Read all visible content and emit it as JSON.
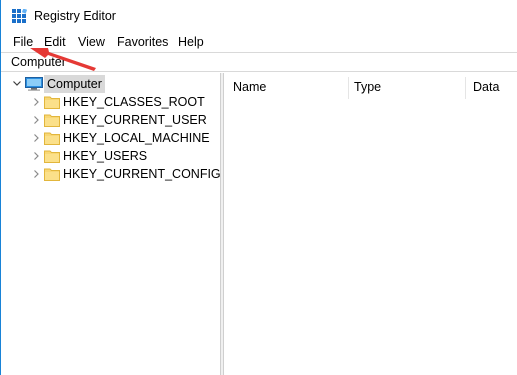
{
  "window": {
    "title": "Registry Editor",
    "accent_color": "#1883d7"
  },
  "menu": {
    "items": [
      {
        "label": "File"
      },
      {
        "label": "Edit"
      },
      {
        "label": "View"
      },
      {
        "label": "Favorites"
      },
      {
        "label": "Help"
      }
    ]
  },
  "address": {
    "path": "Computer"
  },
  "tree": {
    "root": {
      "label": "Computer",
      "icon": "computer-icon",
      "expanded": true,
      "selected": true
    },
    "children": [
      {
        "label": "HKEY_CLASSES_ROOT",
        "icon": "folder-icon"
      },
      {
        "label": "HKEY_CURRENT_USER",
        "icon": "folder-icon"
      },
      {
        "label": "HKEY_LOCAL_MACHINE",
        "icon": "folder-icon"
      },
      {
        "label": "HKEY_USERS",
        "icon": "folder-icon"
      },
      {
        "label": "HKEY_CURRENT_CONFIG",
        "icon": "folder-icon"
      }
    ]
  },
  "list": {
    "columns": [
      {
        "label": "Name"
      },
      {
        "label": "Type"
      },
      {
        "label": "Data"
      }
    ]
  },
  "annotation": {
    "arrow_color": "#e53935",
    "arrow_target": "File"
  }
}
